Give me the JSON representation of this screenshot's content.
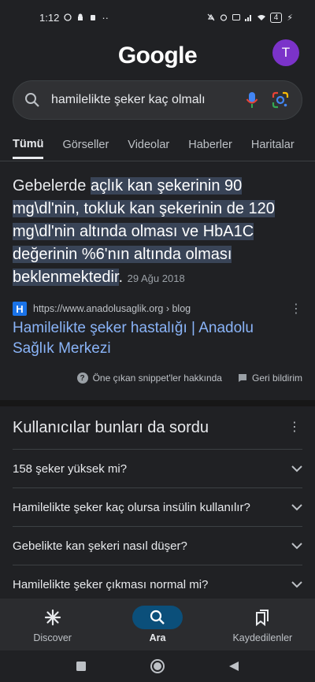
{
  "status_bar": {
    "time": "1:12",
    "battery": "4"
  },
  "header": {
    "logo": "Google",
    "avatar_letter": "T"
  },
  "search": {
    "query": "hamilelikte şeker kaç olmalı"
  },
  "tabs": [
    "Tümü",
    "Görseller",
    "Videolar",
    "Haberler",
    "Haritalar"
  ],
  "snippet": {
    "prefix": "Gebelerde ",
    "highlight": "açlık kan şekerinin 90 mg\\dl'nin, tokluk kan şekerinin de 120 mg\\dl'nin altında olması ve HbA1C değerinin %6'nın altında olması beklenmektedir",
    "suffix": ". ",
    "date": "29 Ağu 2018"
  },
  "result": {
    "favicon_letter": "H",
    "url": "https://www.anadolusaglik.org › blog",
    "title": "Hamilelikte şeker hastalığı | Anadolu Sağlık Merkezi"
  },
  "feedback": {
    "about": "Öne çıkan snippet'ler hakkında",
    "feedback": "Geri bildirim"
  },
  "paa": {
    "title": "Kullanıcılar bunları da sordu",
    "questions": [
      "158 şeker yüksek mi?",
      "Hamilelikte şeker kaç olursa insülin kullanılır?",
      "Gebelikte kan şekeri nasıl düşer?",
      "Hamilelikte şeker çıkması normal mi?"
    ]
  },
  "bottom_nav": {
    "discover": "Discover",
    "search": "Ara",
    "saved": "Kaydedilenler"
  },
  "colors": {
    "background": "#202124",
    "link": "#8ab4f8",
    "highlight": "#394457",
    "avatar": "#7b33c9"
  }
}
